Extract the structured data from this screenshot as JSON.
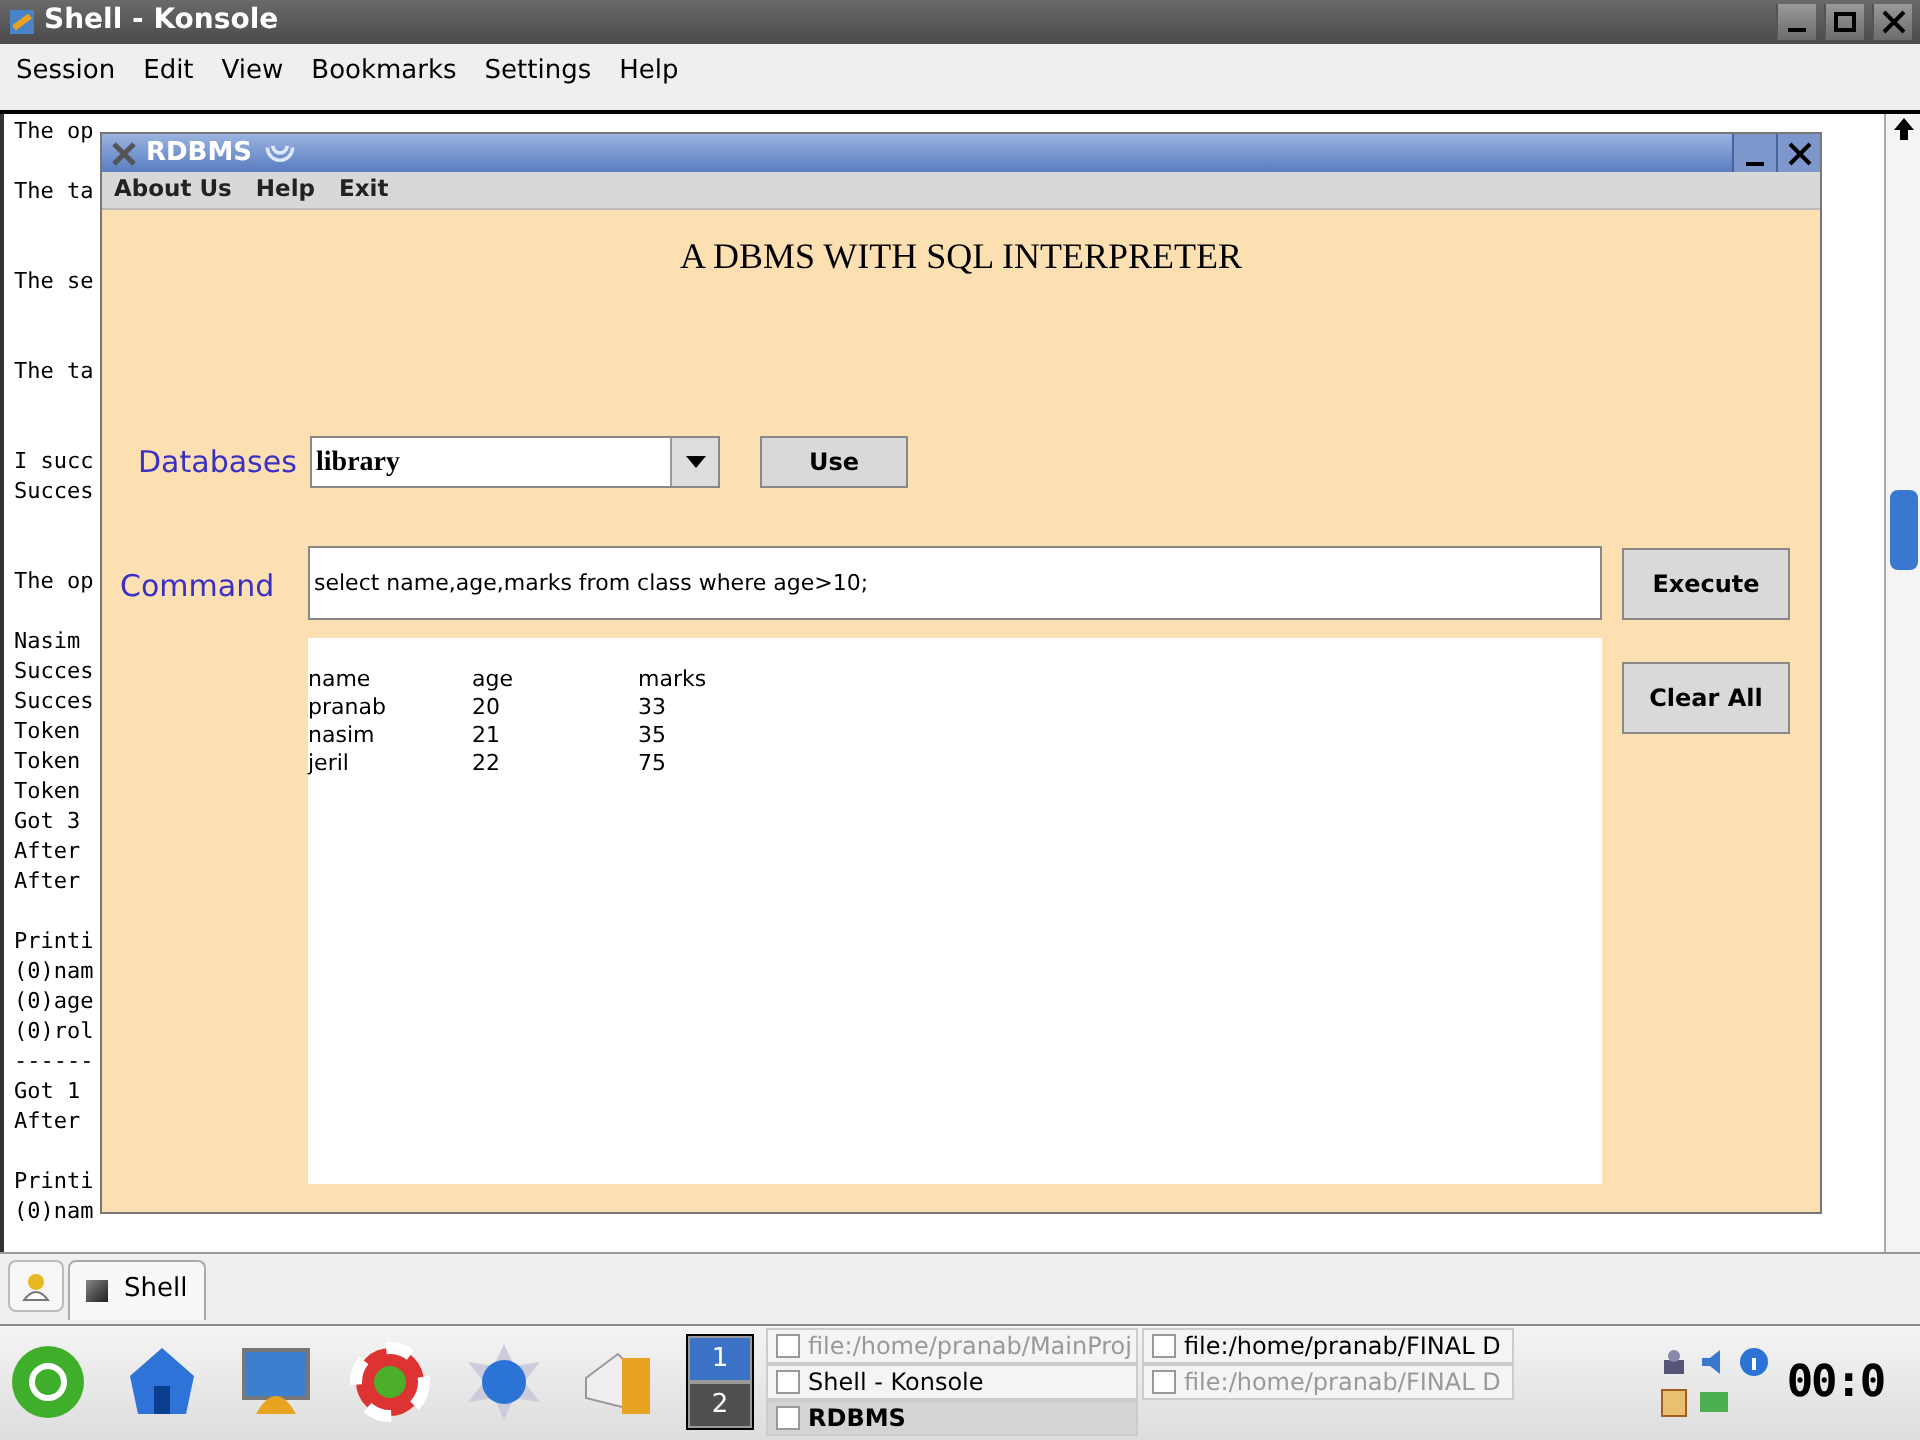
{
  "konsole": {
    "title": "Shell - Konsole",
    "menu": [
      "Session",
      "Edit",
      "View",
      "Bookmarks",
      "Settings",
      "Help"
    ],
    "terminal_lines": [
      {
        "kind": "text",
        "text": "The op"
      },
      {
        "kind": "blank"
      },
      {
        "kind": "text",
        "text": "The ta"
      },
      {
        "kind": "blank"
      },
      {
        "kind": "blank"
      },
      {
        "kind": "text",
        "text": "The se"
      },
      {
        "kind": "blank"
      },
      {
        "kind": "blank"
      },
      {
        "kind": "text",
        "text": "The ta"
      },
      {
        "kind": "blank"
      },
      {
        "kind": "blank"
      },
      {
        "kind": "text",
        "text": "I succ"
      },
      {
        "kind": "text",
        "text": "Succes"
      },
      {
        "kind": "blank"
      },
      {
        "kind": "blank"
      },
      {
        "kind": "text",
        "text": "The op"
      },
      {
        "kind": "blank"
      },
      {
        "kind": "text",
        "text": "Nasim"
      },
      {
        "kind": "text",
        "text": "Succes"
      },
      {
        "kind": "text",
        "text": "Succes"
      },
      {
        "kind": "text",
        "text": "Token"
      },
      {
        "kind": "text",
        "text": "Token"
      },
      {
        "kind": "text",
        "text": "Token"
      },
      {
        "kind": "text",
        "text": "Got 3"
      },
      {
        "kind": "text",
        "text": "After"
      },
      {
        "kind": "text",
        "text": "After"
      },
      {
        "kind": "blank"
      },
      {
        "kind": "text",
        "text": "Printi"
      },
      {
        "kind": "text",
        "text": "(0)nam"
      },
      {
        "kind": "text",
        "text": "(0)age"
      },
      {
        "kind": "text",
        "text": "(0)rol"
      },
      {
        "kind": "text",
        "text": "------"
      },
      {
        "kind": "text",
        "text": "Got 1"
      },
      {
        "kind": "text",
        "text": "After"
      },
      {
        "kind": "blank"
      },
      {
        "kind": "text",
        "text": "Printi"
      },
      {
        "kind": "text",
        "text": "(0)nam"
      }
    ]
  },
  "rdbms": {
    "title": "RDBMS",
    "menu": [
      "About Us",
      "Help",
      "Exit"
    ],
    "heading": "A DBMS WITH SQL INTERPRETER",
    "databases_label": "Databases",
    "database_value": "library",
    "use_button": "Use",
    "command_label": "Command",
    "command_value": "select name,age,marks from class where age>10;",
    "execute_button": "Execute",
    "clear_button": "Clear All",
    "result": {
      "columns": [
        "name",
        "age",
        "marks"
      ],
      "rows": [
        [
          "pranab",
          "20",
          "33"
        ],
        [
          "nasim",
          "21",
          "35"
        ],
        [
          "jeril",
          "22",
          "75"
        ]
      ]
    }
  },
  "konsole_tabs": [
    {
      "label": "Shell",
      "selected": true
    }
  ],
  "panel": {
    "desktops": [
      {
        "label": "1",
        "selected": true
      },
      {
        "label": "2",
        "selected": false
      }
    ],
    "tasks": [
      {
        "label": "file:/home/pranab/MainProj",
        "minimized": true,
        "selected": false
      },
      {
        "label": "file:/home/pranab/FINAL D",
        "minimized": false,
        "selected": false
      },
      {
        "label": "Shell - Konsole",
        "minimized": false,
        "selected": false
      },
      {
        "label": "file:/home/pranab/FINAL D",
        "minimized": true,
        "selected": false
      },
      {
        "label": "RDBMS",
        "minimized": false,
        "selected": true
      }
    ],
    "clock": "00:0"
  }
}
